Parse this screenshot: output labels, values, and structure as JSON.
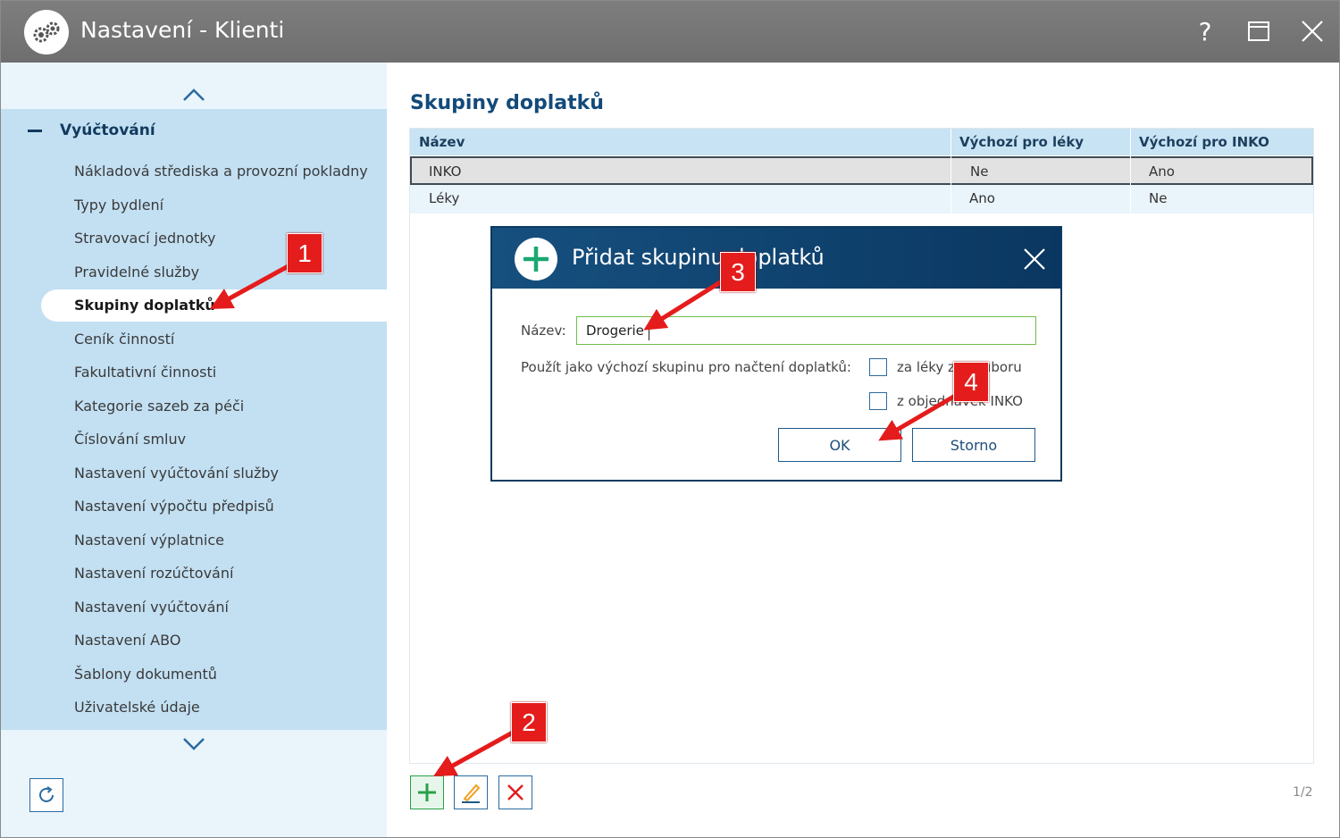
{
  "window": {
    "title": "Nastavení - Klienti",
    "help_label": "?"
  },
  "sidebar": {
    "section": "Vyúčtování",
    "items": [
      {
        "label": "Nákladová střediska a provozní pokladny"
      },
      {
        "label": "Typy bydlení"
      },
      {
        "label": "Stravovací jednotky"
      },
      {
        "label": "Pravidelné služby"
      },
      {
        "label": "Skupiny doplatků",
        "active": true
      },
      {
        "label": "Ceník činností"
      },
      {
        "label": "Fakultativní činnosti"
      },
      {
        "label": "Kategorie sazeb za péči"
      },
      {
        "label": "Číslování smluv"
      },
      {
        "label": "Nastavení vyúčtování služby"
      },
      {
        "label": "Nastavení výpočtu předpisů"
      },
      {
        "label": "Nastavení výplatnice"
      },
      {
        "label": "Nastavení rozúčtování"
      },
      {
        "label": "Nastavení vyúčtování"
      },
      {
        "label": "Nastavení ABO"
      },
      {
        "label": "Šablony dokumentů"
      },
      {
        "label": "Uživatelské údaje"
      }
    ]
  },
  "main": {
    "title": "Skupiny doplatků",
    "columns": [
      "Název",
      "Výchozí pro léky",
      "Výchozí pro INKO"
    ],
    "rows": [
      [
        "INKO",
        "Ne",
        "Ano"
      ],
      [
        "Léky",
        "Ano",
        "Ne"
      ]
    ],
    "pager": "1/2"
  },
  "dialog": {
    "title": "Přidat skupinu doplatků",
    "name_label": "Název:",
    "name_value": "Drogerie",
    "default_label": "Použít jako výchozí skupinu pro načtení doplatků:",
    "checkbox_leky": "za léky ze souboru",
    "checkbox_inko": "z objednávek INKO",
    "ok_label": "OK",
    "cancel_label": "Storno"
  },
  "annotations": [
    "1",
    "2",
    "3",
    "4"
  ],
  "colors": {
    "titlebar": "#767676",
    "sidebar": "#c3e0f3",
    "dialog_header": "#0c3a62",
    "accent_green": "#2aa048",
    "marker_red": "#e51c1c"
  }
}
